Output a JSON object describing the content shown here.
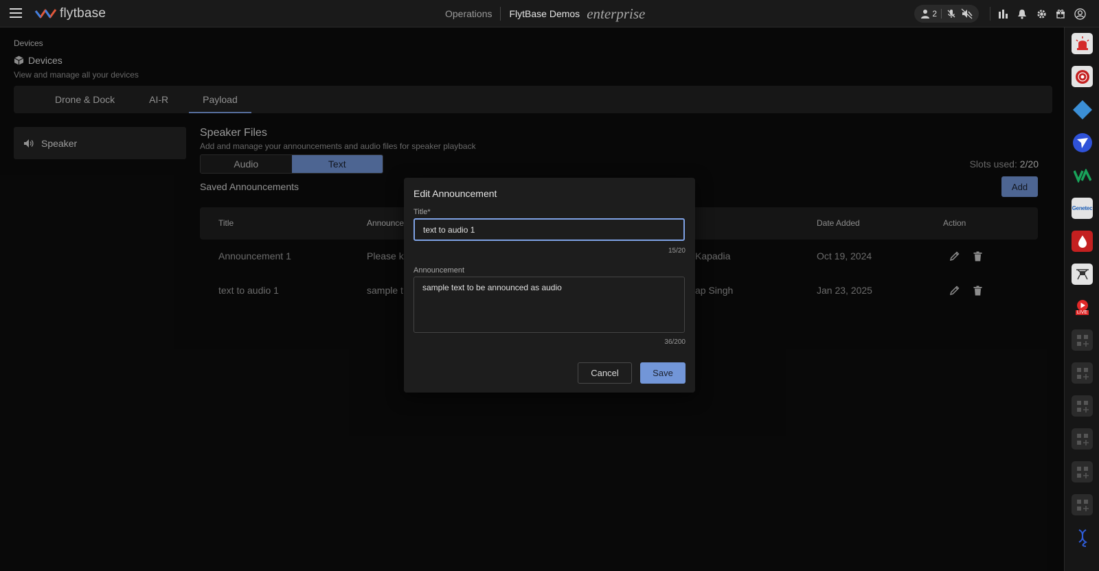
{
  "header": {
    "brand": "flytbase",
    "nav_operations": "Operations",
    "org_name": "FlytBase Demos",
    "edition": "enterprise",
    "users_count": "2"
  },
  "breadcrumb": "Devices",
  "page": {
    "title": "Devices",
    "subtitle": "View and manage all your devices"
  },
  "tabs": [
    "Drone & Dock",
    "AI-R",
    "Payload"
  ],
  "sidebar": {
    "item_label": "Speaker"
  },
  "section": {
    "title": "Speaker Files",
    "subtitle": "Add and manage your announcements and audio files for speaker playback",
    "segments": [
      "Audio",
      "Text"
    ],
    "slots_label": "Slots used:",
    "slots_value": "2/20",
    "saved_title": "Saved Announcements",
    "add_label": "Add"
  },
  "table": {
    "headers": [
      "Title",
      "Announce",
      "Date Added",
      "Action"
    ],
    "rows": [
      {
        "title": "Announcement 1",
        "announcement": "Please ke",
        "added_by": "Kapadia",
        "date": "Oct 19, 2024"
      },
      {
        "title": "text to audio 1",
        "announcement": "sample t",
        "added_by": "ap Singh",
        "date": "Jan 23, 2025"
      }
    ]
  },
  "modal": {
    "title": "Edit Announcement",
    "title_label": "Title*",
    "title_value": "text to audio 1",
    "title_count": "15/20",
    "announcement_label": "Announcement",
    "announcement_value": "sample text to be announced as audio",
    "announcement_count": "36/200",
    "cancel_label": "Cancel",
    "save_label": "Save"
  },
  "rail_icons": [
    "siren-icon",
    "fire-alarm-icon",
    "diamond-icon",
    "send-icon",
    "va-logo-icon",
    "genetec-icon",
    "blood-drop-icon",
    "drone-icon",
    "live-icon",
    "widget-placeholder-icon",
    "widget-placeholder-icon",
    "widget-placeholder-icon",
    "widget-placeholder-icon",
    "widget-placeholder-icon",
    "widget-placeholder-icon",
    "dna-icon"
  ],
  "rail_labels": {
    "genetec": "Genetec",
    "live": "LIVE"
  },
  "colors": {
    "accent": "#7296d8",
    "background": "#0d0d0d",
    "panel": "#1d1d1d"
  }
}
